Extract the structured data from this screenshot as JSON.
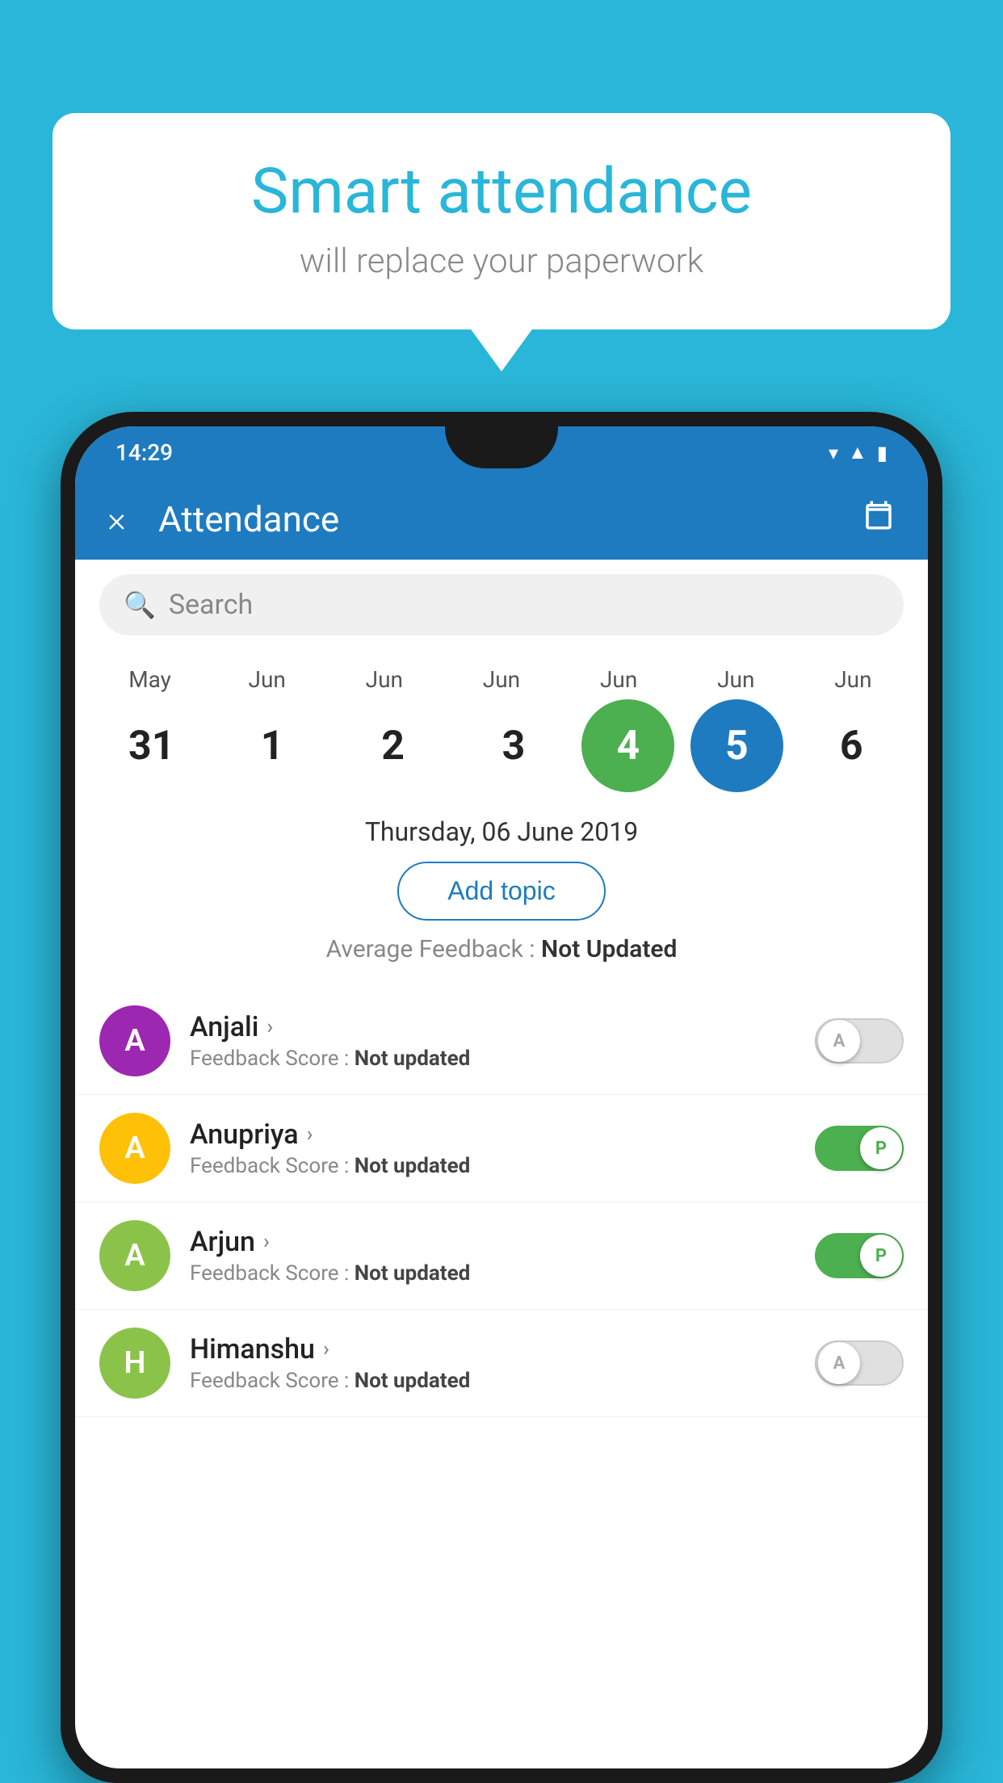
{
  "background_color": "#29b6d8",
  "speech_bubble": {
    "title": "Smart attendance",
    "subtitle": "will replace your paperwork"
  },
  "status_bar": {
    "time": "14:29"
  },
  "app_bar": {
    "title": "Attendance",
    "close_label": "×",
    "calendar_label": "📅"
  },
  "search": {
    "placeholder": "Search"
  },
  "calendar": {
    "months": [
      "May",
      "Jun",
      "Jun",
      "Jun",
      "Jun",
      "Jun",
      "Jun"
    ],
    "dates": [
      "31",
      "1",
      "2",
      "3",
      "4",
      "5",
      "6"
    ],
    "today_index": 4,
    "selected_index": 5,
    "selected_state": "today",
    "selected_label": "5",
    "current_label": "6"
  },
  "selected_date_label": "Thursday, 06 June 2019",
  "add_topic_label": "Add topic",
  "avg_feedback_label": "Average Feedback :",
  "avg_feedback_value": "Not Updated",
  "students": [
    {
      "name": "Anjali",
      "avatar_letter": "A",
      "avatar_color": "#9c27b0",
      "feedback_label": "Feedback Score :",
      "feedback_value": "Not updated",
      "toggle_state": "off",
      "toggle_letter": "A"
    },
    {
      "name": "Anupriya",
      "avatar_letter": "A",
      "avatar_color": "#ffc107",
      "feedback_label": "Feedback Score :",
      "feedback_value": "Not updated",
      "toggle_state": "on",
      "toggle_letter": "P"
    },
    {
      "name": "Arjun",
      "avatar_letter": "A",
      "avatar_color": "#8bc34a",
      "feedback_label": "Feedback Score :",
      "feedback_value": "Not updated",
      "toggle_state": "on",
      "toggle_letter": "P"
    },
    {
      "name": "Himanshu",
      "avatar_letter": "H",
      "avatar_color": "#8bc34a",
      "feedback_label": "Feedback Score :",
      "feedback_value": "Not updated",
      "toggle_state": "off",
      "toggle_letter": "A"
    }
  ]
}
